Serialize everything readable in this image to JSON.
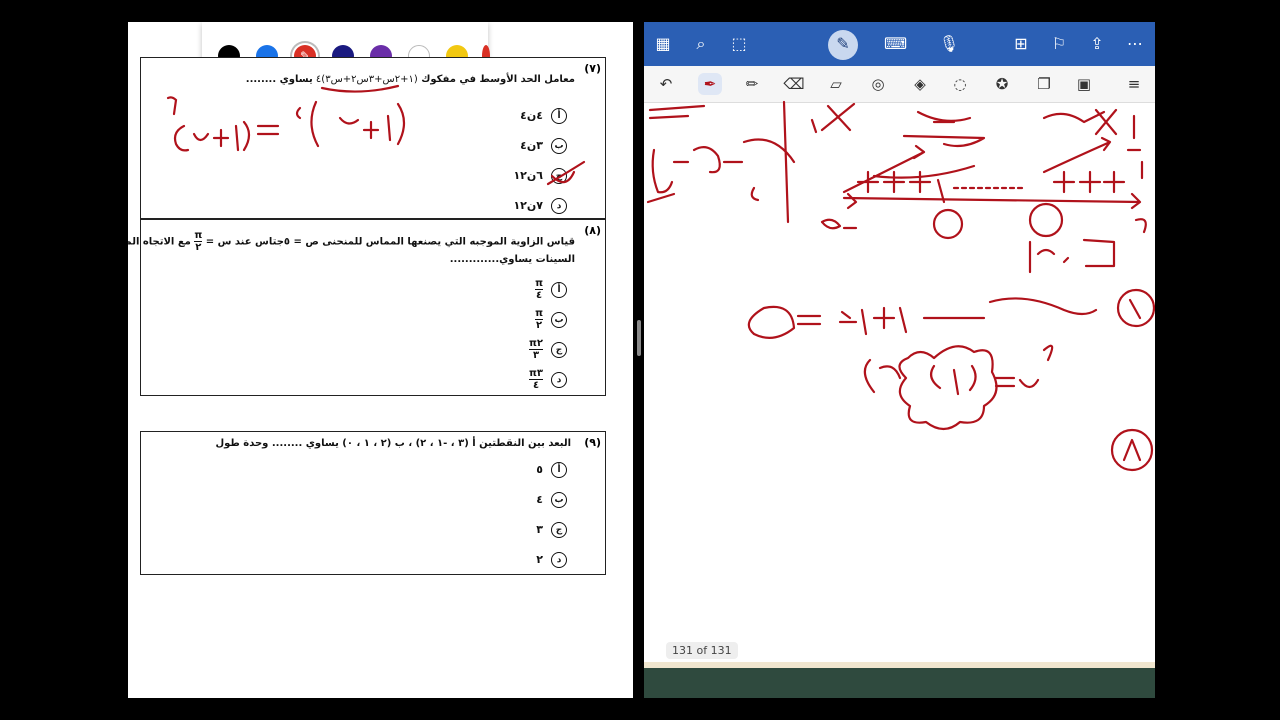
{
  "left_document": {
    "palette": {
      "colors": [
        "#000000",
        "#1a73e8",
        "#d93025",
        "#1a1a80",
        "#6a2ea8",
        "#ffffff",
        "#f2c811"
      ],
      "selected_color": "#d93025"
    },
    "q7": {
      "number": "(٧)",
      "text": "معامل الحد الأوسط في مفكوك",
      "suffix": "يساوي ........",
      "options": [
        {
          "mark": "أ",
          "text": "٤ن٤"
        },
        {
          "mark": "ب",
          "text": "٣ن٤"
        },
        {
          "mark": "ج",
          "text": "٦ن١٢"
        },
        {
          "mark": "د",
          "text": "٧ن١٢"
        }
      ]
    },
    "q8": {
      "number": "(٨)",
      "text": "قياس الزاوية الموجبه التي يصنعها المماس للمنحنى ص = ٥جتاس عند س =",
      "text_tail": "مع الاتجاه الموجب لمحور",
      "line2": "السينات يساوي.............",
      "options": [
        {
          "mark": "أ",
          "num": "π",
          "den": "٤"
        },
        {
          "mark": "ب",
          "num": "π",
          "den": "٢"
        },
        {
          "mark": "ج",
          "num": "π٢",
          "den": "٣"
        },
        {
          "mark": "د",
          "num": "π٣",
          "den": "٤"
        }
      ]
    },
    "q9": {
      "number": "(٩)",
      "text": "البعد بين النقطتين أ (٣ ، -١ ، ٢) ، ب (٢ ، ١ ، ٠)  يساوي  ........  وحدة طول",
      "options": [
        {
          "mark": "أ",
          "text": "٥"
        },
        {
          "mark": "ب",
          "text": "٤"
        },
        {
          "mark": "ج",
          "text": "٣"
        },
        {
          "mark": "د",
          "text": "٢"
        }
      ]
    }
  },
  "right_notebook": {
    "nav_icons": [
      "grid-icon",
      "search-icon",
      "magic-select-icon",
      "pen-mode-icon",
      "keyboard-icon",
      "mic-icon",
      "add-page-icon",
      "bookmark-icon",
      "share-icon",
      "more-icon"
    ],
    "tool_icons": [
      "undo-icon",
      "pen-icon",
      "pencil-icon",
      "eraser-icon",
      "highlighter-icon",
      "shape-icon",
      "image-shapes-icon",
      "lasso-icon",
      "sticker-icon",
      "element-icon",
      "photo-icon"
    ],
    "page_indicator": "131 of 131",
    "ink_color": "#b0121b"
  }
}
